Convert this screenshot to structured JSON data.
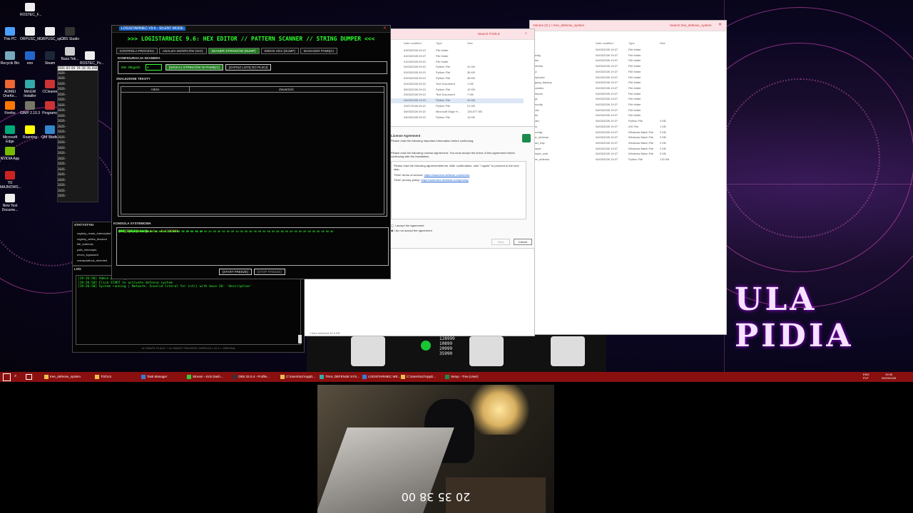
{
  "desktop": {
    "icons": [
      "ROSTEC_F...",
      "This PC",
      "ORPUSC_M...",
      "ORPUSC_sp...",
      "OBS Studio",
      "Recycle Bin",
      "eno",
      "Steam",
      "Baza Tek...",
      "ROSTEC_Pv...",
      "AOMEI OneKe...",
      "MinGW Installer",
      "CCleaner",
      "Chrome",
      "Firefox",
      "GIMP 2.10.3",
      "Programs",
      "Microsoft Edge",
      "Roaming",
      "QM Studio",
      "NVIDIA App",
      "TO MAJNOWS...",
      "New Text Docume..."
    ],
    "wallpaper_text": "ULA PIDIA",
    "digits": [
      "128999",
      "10899",
      "20999",
      "35990"
    ]
  },
  "app": {
    "window_title": "LOGISTARNIEC V9.6 - SILENT MODE",
    "banner": ">>> LOGISTARNIEC 9.6: HEX EDITOR // PATTERN SCANNER // STRING DUMPER <<<",
    "tabs": [
      "KONTROLA PROCESU",
      "ANALIZA WZORCÓW (SIG)",
      "SKANER STRINGÓW (DUMP)",
      "WIDOK HEX (DUMP)",
      "MANAGER PAMIĘCI"
    ],
    "config_label": "KONFIGURACJA SKANERA",
    "min_length_label": "Min. Długość:",
    "min_length_value": "4",
    "scan_button": "[SZUKAJ STRINGÓW W PAMIĘCI]",
    "save_button": "[ZAPISZ LISTĘ DO PLIKU]",
    "found_label": "ZNALEZIONE TEKSTY",
    "columns": [
      "Adres",
      "Zawartość"
    ],
    "console_label": "KONSOLA SYSTEMOWA",
    "console_lines": [
      "[SYSTEM] Base Module: 0x1320000",
      "Podgląd bliższy:",
      "",
      "ADDR: 0x1320000",
      "HEX : 4D 5A 90 00 03 00 00 00 04 00 00 00 FF FF 00 00 B8 00 00 00 00 00 00 00 40 00 00 00 00 00 00 00 00 00 00 00 00 00 00 00 00 00 00 00 00 00",
      "      00 00 00 00 00 00 00 00 00 00 00 00 00 00 01 00 00",
      "TXT : MZ?@"
    ],
    "start_button": "[START FREEZE]",
    "stop_button": "[STOP FREEZE]"
  },
  "statistics": {
    "header": "STATYSTYKI",
    "items": [
      "registry_reads_intercepted",
      "registry_writes_blocked",
      "file_redirects",
      "path_intercepts",
      "errors_bypassed",
      "manipulations_detected"
    ]
  },
  "log": {
    "header": "LOG",
    "lines": [
      "[19:26:50] Admin privileges: <>",
      "[19:26:50] Click START to activate defense system",
      "[19:26:50] System running | Network: Invalid literal for int() with base 10: 'description'"
    ],
    "footer": "ULTIMATE PLACE + ULTIMATE TRACKER | WERSJA v 10.4 + OBRONA"
  },
  "background_log": {
    "first_line": "2026-03-04 19:26:36,044",
    "prefix": "2026-"
  },
  "explorer_tools": {
    "search_placeholder": "Search TOOLS",
    "columns": [
      "Date modified",
      "Type",
      "Size"
    ],
    "rows": [
      [
        "03/03/2026 09:21",
        "File folder",
        ""
      ],
      [
        "04/03/2026 09:27",
        "File folder",
        ""
      ],
      [
        "01/03/2026 09:21",
        "File folder",
        ""
      ],
      [
        "04/03/2026 09:21",
        "Python File",
        "41 KB"
      ],
      [
        "02/03/2026 09:21",
        "Python File",
        "36 KB"
      ],
      [
        "03/03/2026 09:21",
        "Python File",
        "38 KB"
      ],
      [
        "02/03/2026 09:21",
        "Text Document",
        "1 KB"
      ],
      [
        "06/03/2026 09:21",
        "Python File",
        "12 KB"
      ],
      [
        "03/03/2026 09:21",
        "Text Document",
        "7 KB"
      ],
      [
        "04/03/2026 19:21",
        "Python File",
        "42 KB"
      ],
      [
        "23/07/2026 09:21",
        "Python File",
        "21 KB"
      ],
      [
        "05/03/2026 09:21",
        "Microsoft Edge H...",
        "130,577 KB"
      ],
      [
        "04/03/2026 09:21",
        "Python File",
        "14 KB"
      ]
    ],
    "status_items": "24 items",
    "status_selected": "1 item selected  42.5 KB"
  },
  "explorer_tree": {
    "path": "Volume (G:) > tree_defense_system",
    "search_placeholder": "Search tree_defense_system",
    "columns": [
      "Date modified",
      "Type",
      "Size"
    ],
    "rows": [
      [
        "ai",
        "04/03/2026 19:27",
        "File folder",
        ""
      ],
      [
        "config",
        "04/03/2026 19:27",
        "File folder",
        ""
      ],
      [
        "data",
        "04/03/2026 19:27",
        "File folder",
        ""
      ],
      [
        "defense",
        "04/03/2026 19:27",
        "File folder",
        ""
      ],
      [
        "gui",
        "04/03/2026 19:27",
        "File folder",
        ""
      ],
      [
        "keyboard",
        "04/03/2026 19:27",
        "File folder",
        ""
      ],
      [
        "legacy_backup",
        "04/03/2026 19:27",
        "File folder",
        ""
      ],
      [
        "modules",
        "04/03/2026 19:27",
        "File folder",
        ""
      ],
      [
        "network",
        "04/03/2026 19:27",
        "File folder",
        ""
      ],
      [
        "ogs",
        "04/03/2026 19:27",
        "File folder",
        ""
      ],
      [
        "security",
        "04/03/2026 19:27",
        "File folder",
        ""
      ],
      [
        "tools",
        "04/03/2026 19:27",
        "File folder",
        ""
      ],
      [
        "utils",
        "04/03/2026 19:27",
        "File folder",
        ""
      ],
      [
        "main",
        "04/03/2026 19:27",
        "Python File",
        "4 KB"
      ],
      [
        "sys",
        "04/03/2026 19:27",
        "ZIG File",
        "1 KB"
      ],
      [
        "_config",
        "04/03/2026 19:27",
        "Windows Batch File",
        "2 KB"
      ],
      [
        "run_defense",
        "04/03/2026 19:27",
        "Windows Batch File",
        "2 KB"
      ],
      [
        "start_tray",
        "04/03/2026 19:27",
        "Windows Batch File",
        "2 KB"
      ],
      [
        "simple",
        "04/03/2026 19:27",
        "Windows Batch File",
        "2 KB"
      ],
      [
        "simple_web",
        "04/03/2026 19:27",
        "Windows Batch File",
        "2 KB"
      ],
      [
        "tree_defense",
        "04/03/2026 19:27",
        "Python File",
        "176 KB"
      ]
    ]
  },
  "dialog": {
    "title": "License Agreement",
    "subtitle": "Please read the following important information before continuing.",
    "body": "Please read the following License Agreement. You must accept the terms of this agreement before continuing with the installation.",
    "inner_text": "Please read the following agreement/terms. After confirmation, click \"I agree\" to proceed to the next step.",
    "link1_label": "TDAC terms of service:",
    "link1": "https://www.tree-defense.com/terms",
    "link2_label": "TDAC privacy policy:",
    "link2": "https://www.tree-defense.com/privacy",
    "accept": "I accept the agreement",
    "decline": "I do not accept the agreement",
    "next_button": "Next",
    "cancel_button": "Cancel"
  },
  "taskbar": {
    "items": [
      "tree_defense_system",
      "TOOLS",
      "Task Manager",
      "Stream - Kick Dash...",
      "OBS 32.0.4 - Profile...",
      "C:\\Users\\szr\\AppD...",
      "TRAL DEFENSE SYS...",
      "LOGISTARNIEC WE...",
      "C:\\Users\\szr\\AppD...",
      "Setup - Tree (User)"
    ],
    "time": "19:35",
    "date": "04/03/2026",
    "lang": "ENG",
    "lang2": "PLP"
  },
  "webcam": {
    "clock": "20 35 38 00"
  }
}
